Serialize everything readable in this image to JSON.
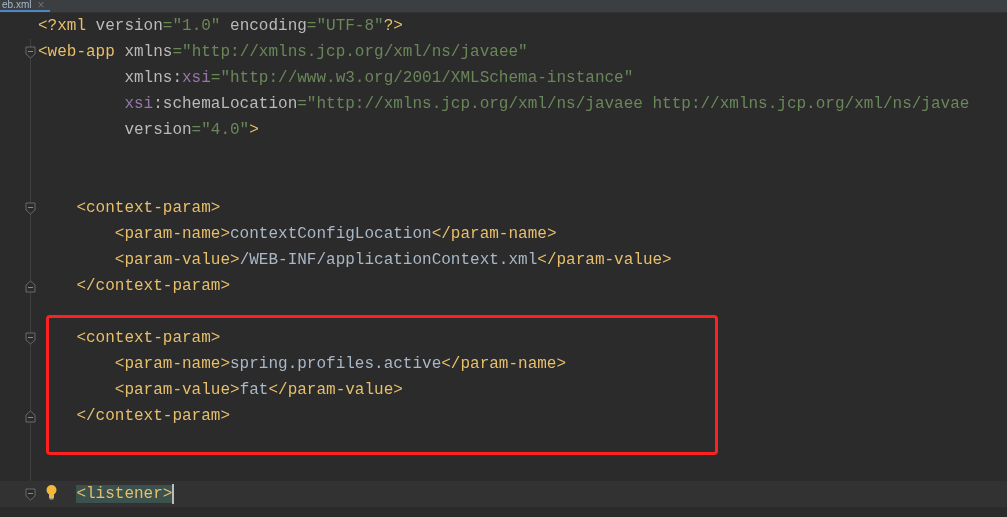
{
  "tab": {
    "label": "eb.xml",
    "close": "×",
    "selected": true
  },
  "lines": [
    {
      "kind": "top",
      "tokens": [
        {
          "kind": "tag",
          "text": "<?xml "
        },
        {
          "kind": "attr",
          "text": "version"
        },
        {
          "kind": "value",
          "text": "=\"1.0\""
        },
        {
          "kind": "attr",
          "text": " encoding"
        },
        {
          "kind": "value",
          "text": "=\"UTF-8\""
        },
        {
          "kind": "tag",
          "text": "?>"
        }
      ]
    },
    {
      "kind": "top",
      "fold_start": true,
      "tokens": [
        {
          "kind": "tag",
          "text": "<web-app"
        },
        {
          "kind": "attr",
          "text": " xmlns"
        },
        {
          "kind": "value",
          "text": "=\"http://xmlns.jcp.org/xml/ns/javaee\""
        }
      ]
    },
    {
      "kind": "continuation",
      "tokens": [
        {
          "kind": "attr",
          "text": "xmlns:"
        },
        {
          "kind": "ns",
          "text": "xsi"
        },
        {
          "kind": "value",
          "text": "=\"http://www.w3.org/2001/XMLSchema-instance\""
        }
      ]
    },
    {
      "kind": "continuation",
      "tokens": [
        {
          "kind": "ns",
          "text": "xsi"
        },
        {
          "kind": "attr",
          "text": ":schemaLocation"
        },
        {
          "kind": "value",
          "text": "=\"http://xmlns.jcp.org/xml/ns/javaee http://xmlns.jcp.org/xml/ns/javae"
        }
      ]
    },
    {
      "kind": "continuation",
      "tokens": [
        {
          "kind": "attr",
          "text": "version"
        },
        {
          "kind": "value",
          "text": "=\"4.0\""
        },
        {
          "kind": "tag",
          "text": ">"
        }
      ]
    },
    {
      "kind": "blank"
    },
    {
      "kind": "blank"
    },
    {
      "kind": "child",
      "fold_start": true,
      "tokens": [
        {
          "kind": "tag",
          "text": "<context-param>"
        }
      ]
    },
    {
      "kind": "grandchild",
      "tokens": [
        {
          "kind": "tag",
          "text": "<param-name>"
        },
        {
          "kind": "text",
          "text": "contextConfigLocation"
        },
        {
          "kind": "tag",
          "text": "</param-name>"
        }
      ]
    },
    {
      "kind": "grandchild",
      "tokens": [
        {
          "kind": "tag",
          "text": "<param-value>"
        },
        {
          "kind": "text",
          "text": "/WEB-INF/applicationContext.xml"
        },
        {
          "kind": "tag",
          "text": "</param-value>"
        }
      ]
    },
    {
      "kind": "child",
      "fold_end": true,
      "tokens": [
        {
          "kind": "tag",
          "text": "</context-param>"
        }
      ]
    },
    {
      "kind": "blank"
    },
    {
      "kind": "child",
      "fold_start": true,
      "boxed": true,
      "tokens": [
        {
          "kind": "tag",
          "text": "<context-param>"
        }
      ]
    },
    {
      "kind": "grandchild",
      "boxed": true,
      "tokens": [
        {
          "kind": "tag",
          "text": "<param-name>"
        },
        {
          "kind": "text",
          "text": "spring.profiles.active"
        },
        {
          "kind": "tag",
          "text": "</param-name>"
        }
      ]
    },
    {
      "kind": "grandchild",
      "boxed": true,
      "tokens": [
        {
          "kind": "tag",
          "text": "<param-value>"
        },
        {
          "kind": "text",
          "text": "fat"
        },
        {
          "kind": "tag",
          "text": "</param-value>"
        }
      ]
    },
    {
      "kind": "child",
      "fold_end": true,
      "boxed": true,
      "tokens": [
        {
          "kind": "tag",
          "text": "</context-param>"
        }
      ]
    },
    {
      "kind": "blank",
      "boxed": true
    },
    {
      "kind": "blank"
    },
    {
      "kind": "child",
      "fold_start": true,
      "bulb": true,
      "current": true,
      "tokens": [
        {
          "kind": "tag",
          "text": "<listener>"
        }
      ]
    }
  ]
}
